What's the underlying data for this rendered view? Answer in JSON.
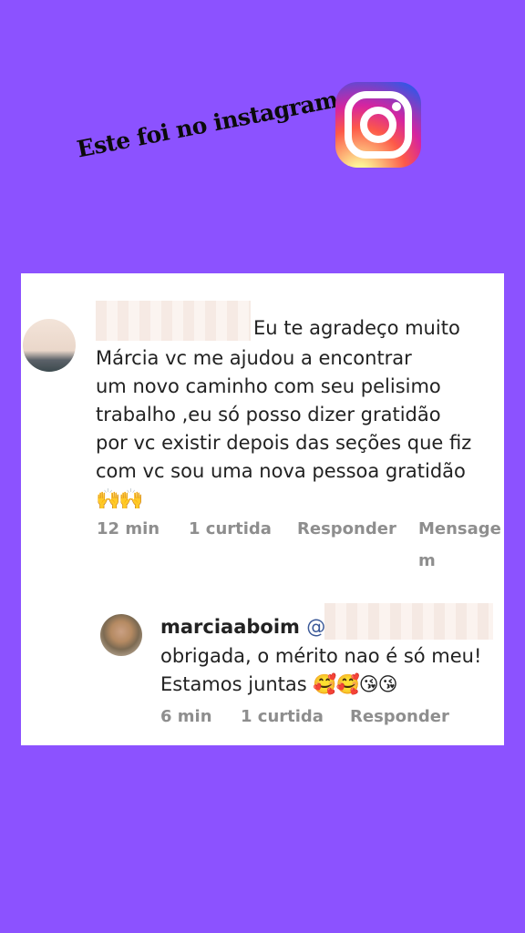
{
  "caption": "Este foi no instagram",
  "logo": {
    "name": "instagram-logo"
  },
  "comment": {
    "first_line": "Eu te agradeço  muito",
    "lines": [
      "Márcia  vc  me ajudou  a encontrar",
      "um novo caminho com seu pelisimo",
      "trabalho ,eu só posso dizer gratidão",
      "por vc existir depois das seções que fiz",
      "com vc sou uma nova pessoa  gratidão"
    ],
    "emoji": "🙌🙌",
    "time": "12 min",
    "likes": "1 curtida",
    "reply": "Responder",
    "message": "Mensage",
    "message_wrap": "m"
  },
  "reply": {
    "username": "marciaaboim",
    "at": "@",
    "line1": "obrigada, o mérito nao é só meu!",
    "line2": "Estamos juntas ",
    "emoji": "🥰🥰😘😘",
    "time": "6 min",
    "likes": "1 curtida",
    "reply": "Responder"
  },
  "colors": {
    "background": "#8c52ff",
    "meta_text": "#8e8e8e",
    "body_text": "#222222"
  }
}
